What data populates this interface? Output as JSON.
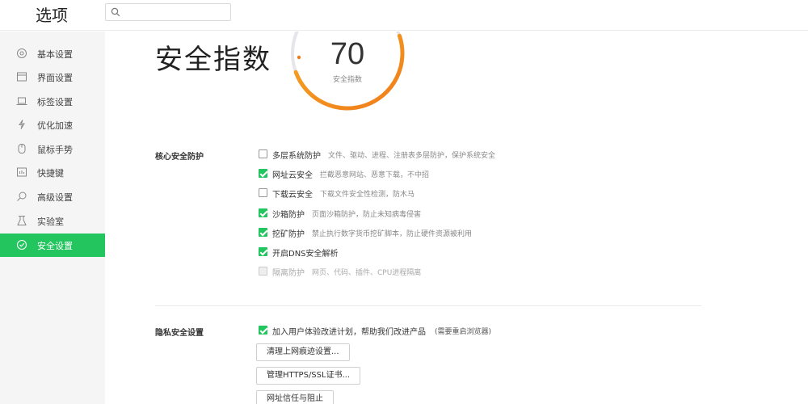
{
  "header": {
    "title": "选项",
    "search_placeholder": "",
    "search_icon": "search-icon"
  },
  "sidebar": {
    "items": [
      {
        "label": "基本设置",
        "icon": "circle-settings-icon",
        "active": false
      },
      {
        "label": "界面设置",
        "icon": "window-icon",
        "active": false
      },
      {
        "label": "标签设置",
        "icon": "laptop-icon",
        "active": false
      },
      {
        "label": "优化加速",
        "icon": "lightning-icon",
        "active": false
      },
      {
        "label": "鼠标手势",
        "icon": "mouse-icon",
        "active": false
      },
      {
        "label": "快捷键",
        "icon": "keyboard-icon",
        "active": false
      },
      {
        "label": "高级设置",
        "icon": "magnifier-icon",
        "active": false
      },
      {
        "label": "实验室",
        "icon": "flask-icon",
        "active": false
      },
      {
        "label": "安全设置",
        "icon": "shield-check-icon",
        "active": true
      }
    ],
    "active_color": "#22c55e"
  },
  "main": {
    "hero_title": "安全指数",
    "score": "70",
    "score_label": "安全指数",
    "score_fraction": 0.7,
    "core": {
      "title": "核心安全防护",
      "options": [
        {
          "label": "多层系统防护",
          "desc": "文件、驱动、进程、注册表多层防护，保护系统安全",
          "checked": false,
          "disabled": false
        },
        {
          "label": "网址云安全",
          "desc": "拦截恶意网站、恶意下载，不中招",
          "checked": true,
          "disabled": false
        },
        {
          "label": "下载云安全",
          "desc": "下载文件安全性检测，防木马",
          "checked": false,
          "disabled": false
        },
        {
          "label": "沙箱防护",
          "desc": "页面沙箱防护，防止未知病毒侵害",
          "checked": true,
          "disabled": false
        },
        {
          "label": "挖矿防护",
          "desc": "禁止执行数字货币挖矿脚本，防止硬件资源被利用",
          "checked": true,
          "disabled": false
        },
        {
          "label": "开启DNS安全解析",
          "desc": "",
          "checked": true,
          "disabled": false
        },
        {
          "label": "隔离防护",
          "desc": "网页、代码、插件、CPU进程隔离",
          "checked": true,
          "disabled": true
        }
      ]
    },
    "privacy": {
      "title": "隐私安全设置",
      "options": [
        {
          "label": "加入用户体验改进计划，帮助我们改进产品",
          "desc": "(需要重启浏览器)",
          "checked": true,
          "disabled": false
        }
      ],
      "buttons": [
        "清理上网痕迹设置...",
        "管理HTTPS/SSL证书...",
        "网址信任与阻止"
      ]
    }
  },
  "colors": {
    "accent": "#22c55e",
    "gauge_start": "#f5a623",
    "gauge_end": "#f07c1a",
    "gauge_track": "#e6e6ea"
  }
}
